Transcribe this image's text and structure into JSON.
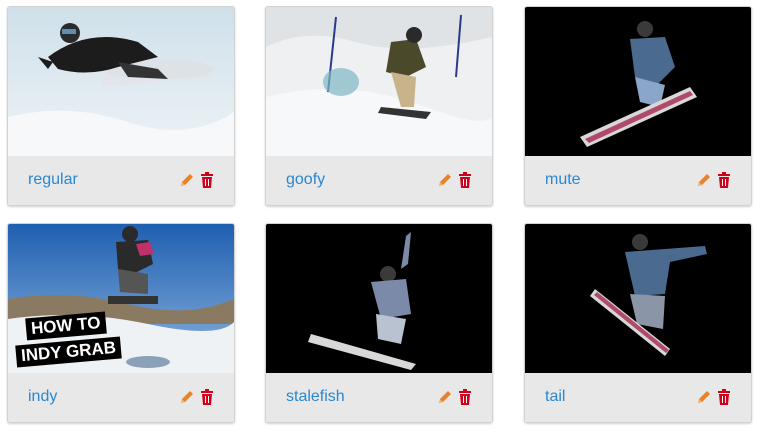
{
  "cards": [
    {
      "label": "regular",
      "image": "snowboarder-regular-photo",
      "edit_icon": "pencil-icon",
      "delete_icon": "trash-icon"
    },
    {
      "label": "goofy",
      "image": "snowboarder-goofy-photo",
      "edit_icon": "pencil-icon",
      "delete_icon": "trash-icon"
    },
    {
      "label": "mute",
      "image": "snowboarder-mute-grab-photo",
      "edit_icon": "pencil-icon",
      "delete_icon": "trash-icon"
    },
    {
      "label": "indy",
      "image": "snowboarder-indy-grab-photo",
      "overlay_text": [
        "HOW TO",
        "INDY GRAB"
      ],
      "edit_icon": "pencil-icon",
      "delete_icon": "trash-icon"
    },
    {
      "label": "stalefish",
      "image": "snowboarder-stalefish-grab-photo",
      "edit_icon": "pencil-icon",
      "delete_icon": "trash-icon"
    },
    {
      "label": "tail",
      "image": "snowboarder-tail-grab-photo",
      "edit_icon": "pencil-icon",
      "delete_icon": "trash-icon"
    }
  ],
  "colors": {
    "link": "#2a87d0",
    "edit": "#e8822a",
    "delete": "#d0021b",
    "card_footer": "#e8e8e8"
  }
}
